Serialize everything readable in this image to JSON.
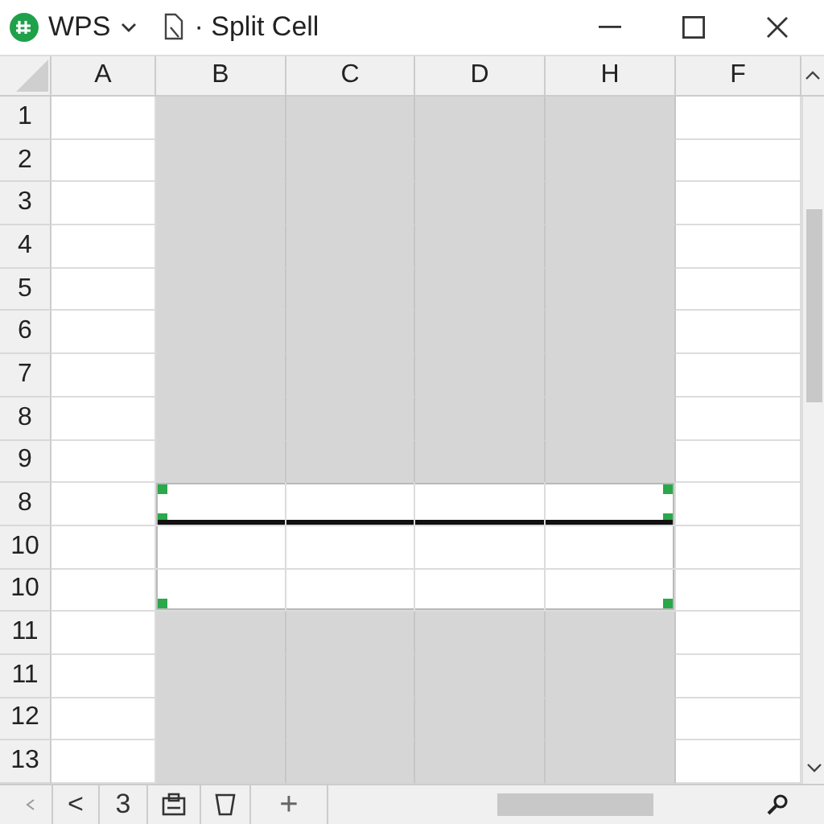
{
  "window": {
    "app": "WPS",
    "title": "· Split Cell"
  },
  "columns": [
    {
      "label": "A",
      "selected": false
    },
    {
      "label": "B",
      "selected": true
    },
    {
      "label": "C",
      "selected": true
    },
    {
      "label": "D",
      "selected": true
    },
    {
      "label": "H",
      "selected": true
    },
    {
      "label": "F",
      "selected": false
    }
  ],
  "rows": [
    {
      "label": "1",
      "selected": false,
      "split_line": false
    },
    {
      "label": "2",
      "selected": false,
      "split_line": false
    },
    {
      "label": "3",
      "selected": false,
      "split_line": false
    },
    {
      "label": "4",
      "selected": false,
      "split_line": false
    },
    {
      "label": "5",
      "selected": false,
      "split_line": false
    },
    {
      "label": "6",
      "selected": false,
      "split_line": false
    },
    {
      "label": "7",
      "selected": false,
      "split_line": false
    },
    {
      "label": "8",
      "selected": false,
      "split_line": false
    },
    {
      "label": "9",
      "selected": false,
      "split_line": false
    },
    {
      "label": "8",
      "selected": true,
      "split_line": true
    },
    {
      "label": "10",
      "selected": true,
      "split_line": false
    },
    {
      "label": "10",
      "selected": true,
      "split_line": false
    },
    {
      "label": "11",
      "selected": false,
      "split_line": false
    },
    {
      "label": "11",
      "selected": false,
      "split_line": false
    },
    {
      "label": "12",
      "selected": false,
      "split_line": false
    },
    {
      "label": "13",
      "selected": false,
      "split_line": false
    }
  ],
  "sheet_bar": {
    "prev": "<",
    "sheet": "3",
    "add": "+"
  }
}
